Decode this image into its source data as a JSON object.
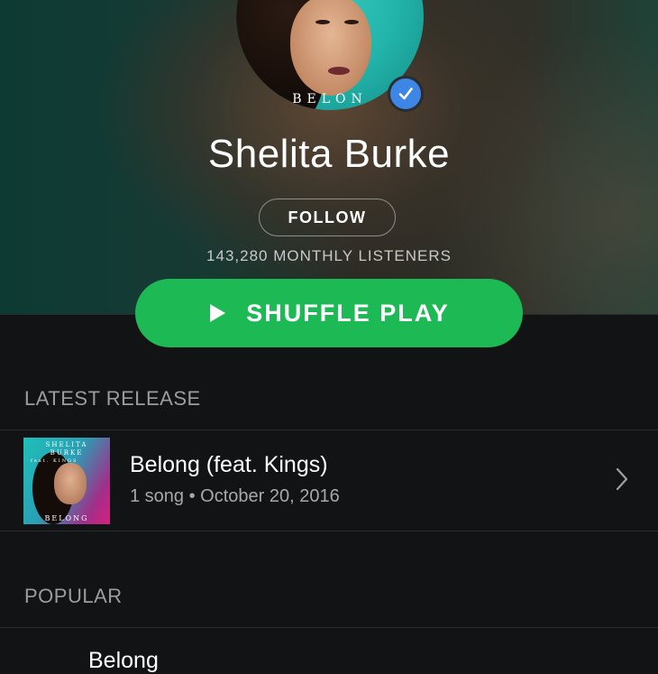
{
  "artist": {
    "name": "Shelita Burke",
    "avatar_text": "BELON",
    "verified_icon": "checkmark-icon",
    "follow_label": "FOLLOW",
    "monthly_listeners": "143,280 MONTHLY LISTENERS"
  },
  "shuffle": {
    "label": "SHUFFLE PLAY",
    "icon": "play-icon",
    "color": "#1db954"
  },
  "latest_release": {
    "section_label": "LATEST RELEASE",
    "title": "Belong (feat. Kings)",
    "meta": "1 song • October 20, 2016",
    "art_title_1": "SHELITA",
    "art_title_2": "BURKE",
    "art_title_3": "feat. KINGS",
    "art_footer": "BELONG",
    "chevron_icon": "chevron-right-icon"
  },
  "popular": {
    "section_label": "POPULAR",
    "first_item_peek": "Belong"
  }
}
